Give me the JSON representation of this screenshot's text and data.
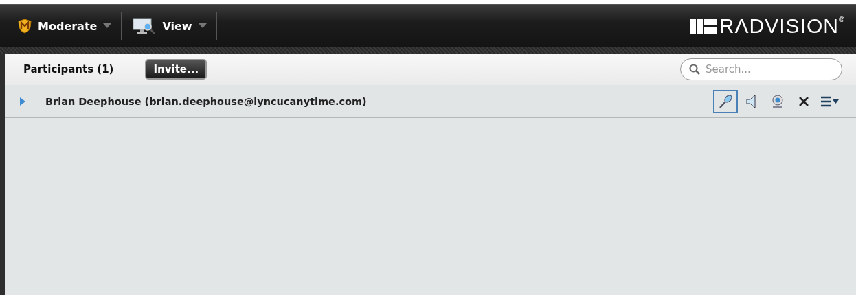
{
  "toolbar": {
    "menus": [
      {
        "label": "Moderate",
        "kind": "moderate"
      },
      {
        "label": "View",
        "kind": "view"
      }
    ],
    "logo": "RΛDVISION$^{®}$"
  },
  "participants_panel": {
    "title": "Participants (1)",
    "invite_button": "Invite...",
    "search": {
      "placeholder": "Search..."
    },
    "participants": [
      {
        "name": "Brian Deephouse (brian.deephouse@lyncucanytime.com)",
        "expanded": false,
        "controls": [
          {
            "kind": "microphone",
            "selected": true
          },
          {
            "kind": "speaker",
            "selected": false
          },
          {
            "kind": "camera",
            "selected": false
          },
          {
            "kind": "remove",
            "selected": false
          },
          {
            "kind": "menu",
            "selected": false
          }
        ]
      }
    ]
  }
}
